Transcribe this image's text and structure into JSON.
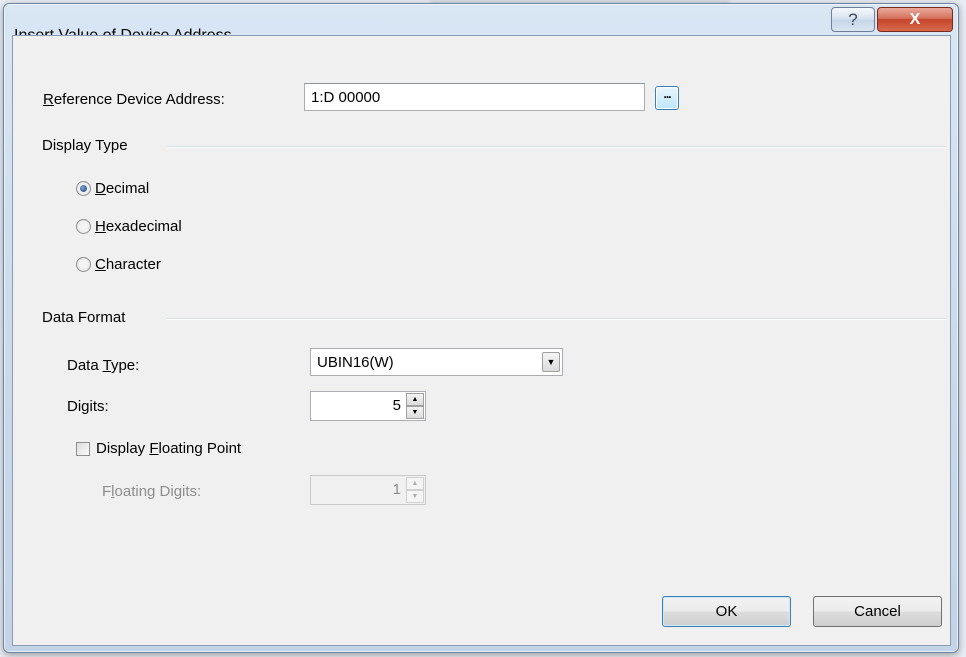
{
  "window": {
    "title": "Insert Value of Device Address",
    "help_glyph": "?",
    "close_glyph": "X"
  },
  "reference": {
    "label": "Reference Device Address:",
    "mnemonic": "R",
    "value": "1:D 00000",
    "browse_label": "..."
  },
  "display_type": {
    "group_title": "Display Type",
    "options": [
      {
        "label": "Decimal",
        "mnemonic": "D",
        "selected": true
      },
      {
        "label": "Hexadecimal",
        "mnemonic": "H",
        "selected": false
      },
      {
        "label": "Character",
        "mnemonic": "C",
        "selected": false
      }
    ]
  },
  "data_format": {
    "group_title": "Data Format",
    "data_type_label": "Data Type:",
    "data_type_value": "UBIN16(W)",
    "digits_label": "Digits:",
    "digits_value": "5",
    "floating_point_label": "Display Floating Point",
    "floating_point_checked": false,
    "floating_digits_label": "Floating Digits:",
    "floating_digits_value": "1"
  },
  "buttons": {
    "ok": "OK",
    "cancel": "Cancel"
  },
  "icons": {
    "help": "help-icon",
    "close": "close-icon",
    "dropdown": "chevron-down-icon",
    "spin_up": "spin-up-icon",
    "spin_down": "spin-down-icon"
  }
}
